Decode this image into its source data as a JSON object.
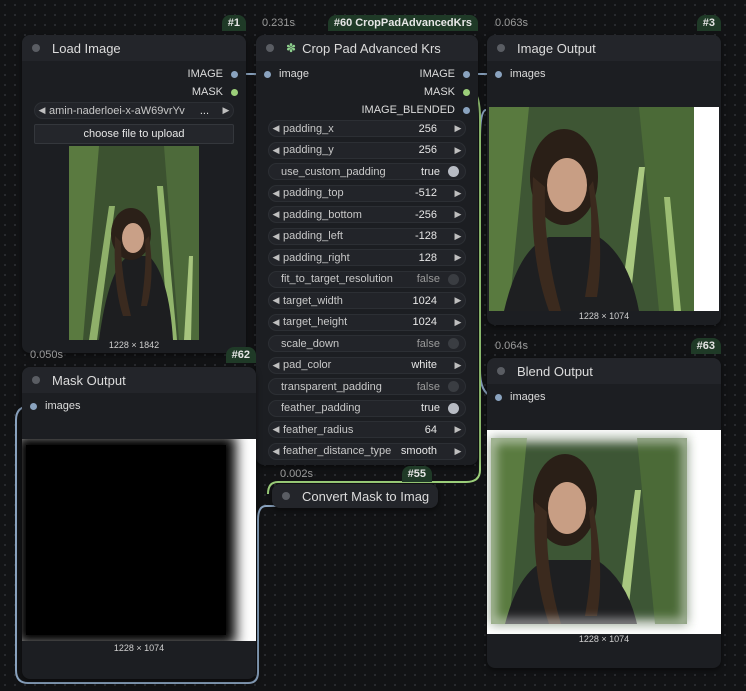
{
  "nodes": {
    "load_image": {
      "id": "#1",
      "title": "Load Image",
      "outputs": [
        "IMAGE",
        "MASK"
      ],
      "file": "amin-naderloei-x-aW69vrYv",
      "file_suffix": "...",
      "upload_label": "choose file to upload",
      "dims": "1228 × 1842"
    },
    "crop_pad": {
      "id": "#60 CropPadAdvancedKrs",
      "timing": "0.231s",
      "title": "Crop Pad Advanced Krs",
      "input": "image",
      "outputs": [
        "IMAGE",
        "MASK",
        "IMAGE_BLENDED"
      ],
      "widgets": [
        {
          "label": "padding_x",
          "value": "256",
          "type": "number"
        },
        {
          "label": "padding_y",
          "value": "256",
          "type": "number"
        },
        {
          "label": "use_custom_padding",
          "value": "true",
          "type": "toggle"
        },
        {
          "label": "padding_top",
          "value": "-512",
          "type": "number"
        },
        {
          "label": "padding_bottom",
          "value": "-256",
          "type": "number"
        },
        {
          "label": "padding_left",
          "value": "-128",
          "type": "number"
        },
        {
          "label": "padding_right",
          "value": "128",
          "type": "number"
        },
        {
          "label": "fit_to_target_resolution",
          "value": "false",
          "type": "toggle"
        },
        {
          "label": "target_width",
          "value": "1024",
          "type": "number"
        },
        {
          "label": "target_height",
          "value": "1024",
          "type": "number"
        },
        {
          "label": "scale_down",
          "value": "false",
          "type": "toggle"
        },
        {
          "label": "pad_color",
          "value": "white",
          "type": "number"
        },
        {
          "label": "transparent_padding",
          "value": "false",
          "type": "toggle"
        },
        {
          "label": "feather_padding",
          "value": "true",
          "type": "toggle"
        },
        {
          "label": "feather_radius",
          "value": "64",
          "type": "number"
        },
        {
          "label": "feather_distance_type",
          "value": "smooth",
          "type": "number"
        }
      ]
    },
    "image_output": {
      "id": "#3",
      "timing": "0.063s",
      "title": "Image Output",
      "input": "images",
      "dims": "1228 × 1074"
    },
    "mask_output": {
      "id": "#62",
      "timing": "0.050s",
      "title": "Mask Output",
      "input": "images",
      "dims": "1228 × 1074"
    },
    "blend_output": {
      "id": "#63",
      "timing": "0.064s",
      "title": "Blend Output",
      "input": "images",
      "dims": "1228 × 1074"
    },
    "convert_mask": {
      "id": "#55",
      "timing": "0.002s",
      "title": "Convert Mask to Imag"
    }
  },
  "colors": {
    "image_port": "#8aa3bf",
    "mask_port": "#9ccf7a",
    "badge_bg": "#1f3a27"
  }
}
